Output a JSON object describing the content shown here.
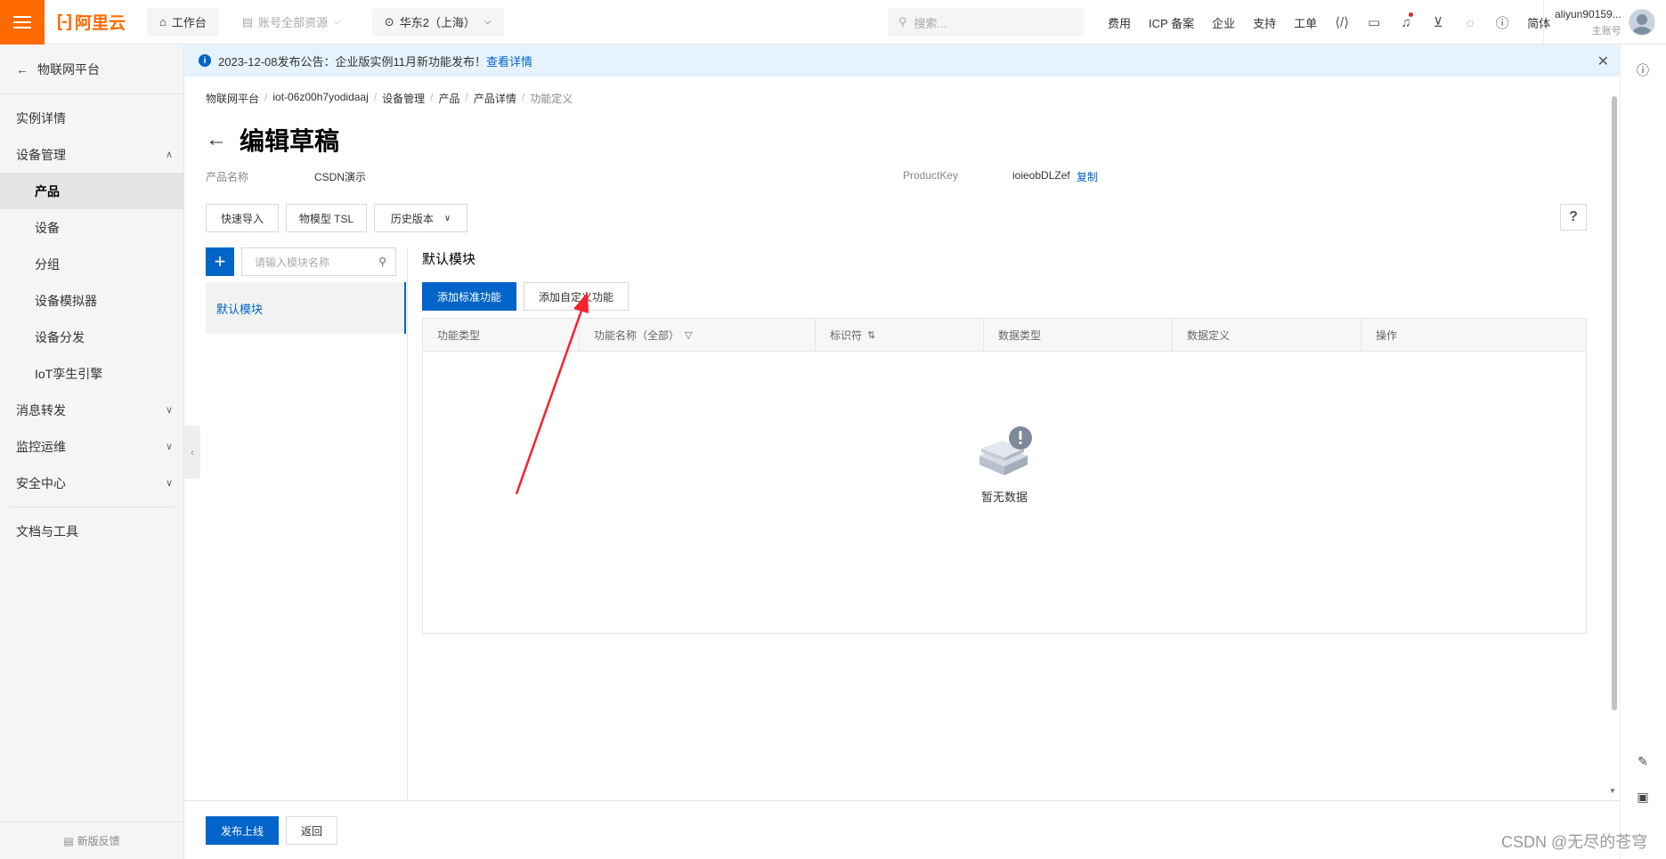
{
  "topbar": {
    "logo": "阿里云",
    "workbench": "工作台",
    "resources": "账号全部资源",
    "region": "华东2（上海）",
    "search_placeholder": "搜索...",
    "nav": [
      "费用",
      "ICP 备案",
      "企业",
      "支持",
      "工单"
    ],
    "lang": "简体",
    "user_name": "aliyun90159...",
    "user_sub": "主账号"
  },
  "notice": {
    "text": "2023-12-08发布公告：企业版实例11月新功能发布！",
    "link": "查看详情"
  },
  "sidebar": {
    "back": "物联网平台",
    "items": [
      "实例详情",
      "设备管理",
      "产品",
      "设备",
      "分组",
      "设备模拟器",
      "设备分发",
      "IoT孪生引擎",
      "消息转发",
      "监控运维",
      "安全中心",
      "文档与工具"
    ],
    "feedback": "新版反馈"
  },
  "breadcrumb": [
    "物联网平台",
    "iot-06z00h7yodidaaj",
    "设备管理",
    "产品",
    "产品详情",
    "功能定义"
  ],
  "page": {
    "title": "编辑草稿",
    "product_name_label": "产品名称",
    "product_name": "CSDN演示",
    "product_key_label": "ProductKey",
    "product_key": "ioieobDLZef",
    "copy": "复制"
  },
  "toolbar": {
    "quick_import": "快速导入",
    "tsl": "物模型 TSL",
    "history": "历史版本",
    "help": "?"
  },
  "modules": {
    "search_placeholder": "请输入模块名称",
    "items": [
      "默认模块"
    ]
  },
  "section": {
    "title": "默认模块",
    "add_standard": "添加标准功能",
    "add_custom": "添加自定义功能"
  },
  "table": {
    "columns": [
      "功能类型",
      "功能名称（全部）",
      "标识符",
      "数据类型",
      "数据定义",
      "操作"
    ],
    "empty": "暂无数据"
  },
  "footer": {
    "publish": "发布上线",
    "back": "返回"
  },
  "watermark": "CSDN @无尽的苍穹",
  "colors": {
    "brand": "#ff6a00",
    "primary": "#0064c8",
    "annotation": "#f5222d"
  }
}
